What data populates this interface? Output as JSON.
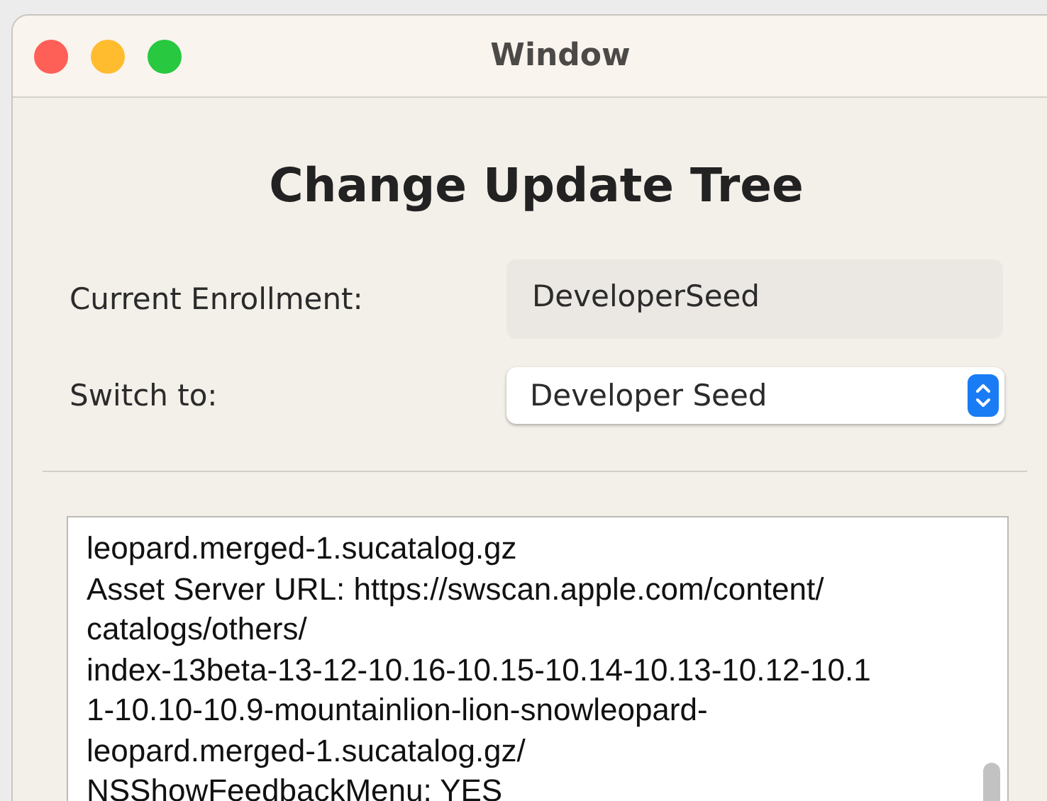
{
  "window": {
    "title": "Window"
  },
  "heading": "Change Update Tree",
  "current": {
    "label": "Current Enrollment:",
    "value": "DeveloperSeed"
  },
  "switch": {
    "label": "Switch to:",
    "value": "Developer Seed"
  },
  "output_lines": [
    "leopard.merged-1.sucatalog.gz",
    "Asset Server URL: https://swscan.apple.com/content/",
    "catalogs/others/",
    "index-13beta-13-12-10.16-10.15-10.14-10.13-10.12-10.1",
    "1-10.10-10.9-mountainlion-lion-snowleopard-",
    "leopard.merged-1.sucatalog.gz/",
    "NSShowFeedbackMenu: YES"
  ]
}
